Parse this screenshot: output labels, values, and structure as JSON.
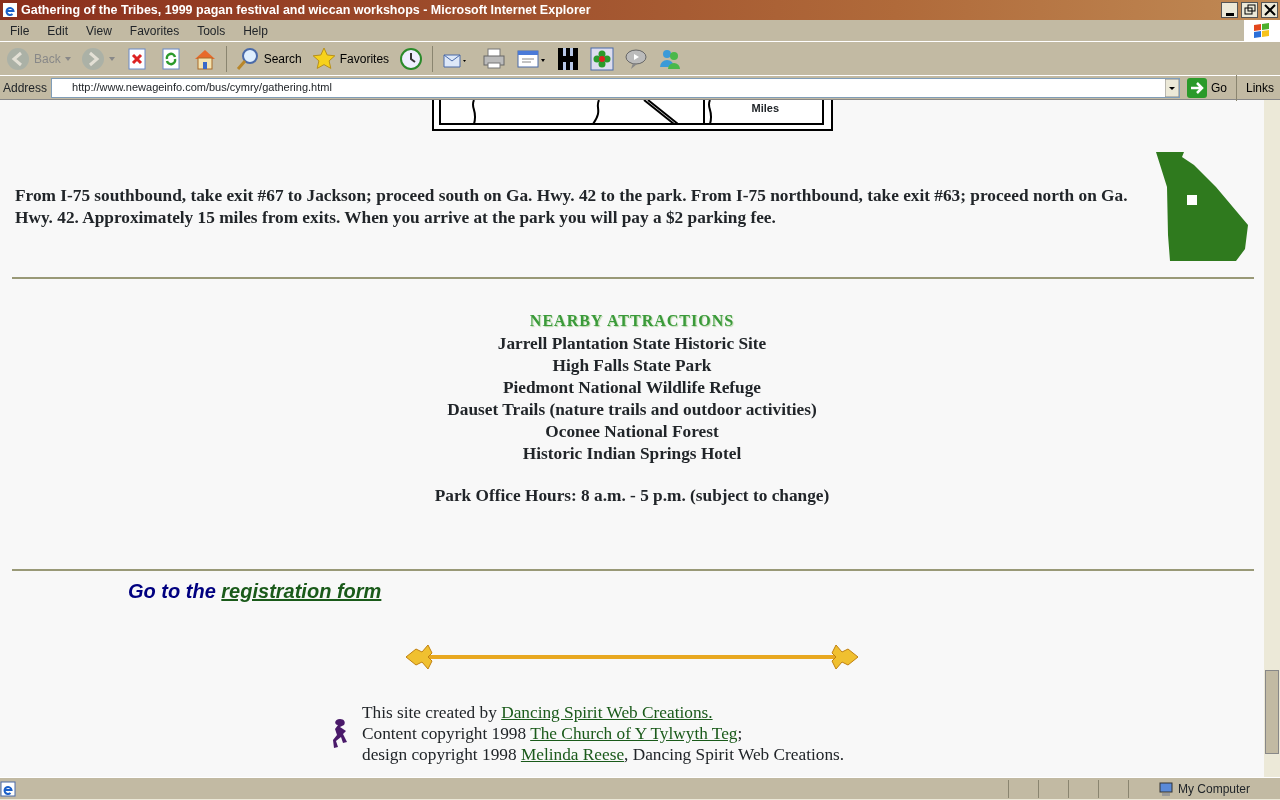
{
  "window": {
    "title": "Gathering of the Tribes, 1999 pagan festival and wiccan workshops - Microsoft Internet Explorer"
  },
  "menu": [
    "File",
    "Edit",
    "View",
    "Favorites",
    "Tools",
    "Help"
  ],
  "toolbar": [
    {
      "kind": "back",
      "label": "Back",
      "disabled": true
    },
    {
      "kind": "forward",
      "disabled": true
    },
    {
      "kind": "stop",
      "disabled": false
    },
    {
      "kind": "refresh",
      "disabled": false
    },
    {
      "kind": "home",
      "disabled": false
    },
    {
      "kind": "search",
      "label": "Search",
      "disabled": false
    },
    {
      "kind": "favorites",
      "label": "Favorites",
      "disabled": false
    },
    {
      "kind": "history",
      "disabled": false
    },
    {
      "kind": "mail",
      "disabled": false
    },
    {
      "kind": "print",
      "disabled": false
    },
    {
      "kind": "edit",
      "disabled": false
    },
    {
      "kind": "h",
      "disabled": false
    },
    {
      "kind": "flower",
      "disabled": false
    },
    {
      "kind": "chat",
      "disabled": false
    },
    {
      "kind": "messenger",
      "disabled": false
    }
  ],
  "address": {
    "label": "Address",
    "value": "http://www.newageinfo.com/bus/cymry/gathering.html",
    "go": "Go",
    "links": "Links"
  },
  "content": {
    "map": {
      "label": "Miles"
    },
    "directions": "From I-75 southbound, take exit #67 to Jackson; proceed south on Ga. Hwy. 42 to the park. From I-75 northbound, take exit #63; proceed north on Ga. Hwy. 42. Approximately 15 miles from exits.  When you arrive at the park you will pay a $2 parking fee.",
    "attractions": {
      "heading": "NEARBY ATTRACTIONS",
      "items": [
        "Jarrell Plantation State Historic Site",
        "High Falls State Park",
        "Piedmont National Wildlife Refuge",
        "Dauset Trails (nature trails and outdoor activities)",
        "Oconee National Forest",
        "Historic Indian Springs Hotel"
      ]
    },
    "hours": "Park Office Hours: 8 a.m. - 5 p.m. (subject to change)",
    "registration": {
      "prefix": "Go to the",
      "link": "registration form"
    },
    "footer": [
      {
        "text": "This site created by",
        "link": "Dancing Spirit Web Creations."
      },
      {
        "text": "Content copyright 1998",
        "link": "The Church of Y Tylwyth Teg",
        "after": ";"
      },
      {
        "text": "design copyright 1998",
        "link": "Melinda Reese",
        "after": ", Dancing Spirit Web Creations."
      }
    ]
  },
  "status_bar": {
    "zone": "My Computer"
  }
}
